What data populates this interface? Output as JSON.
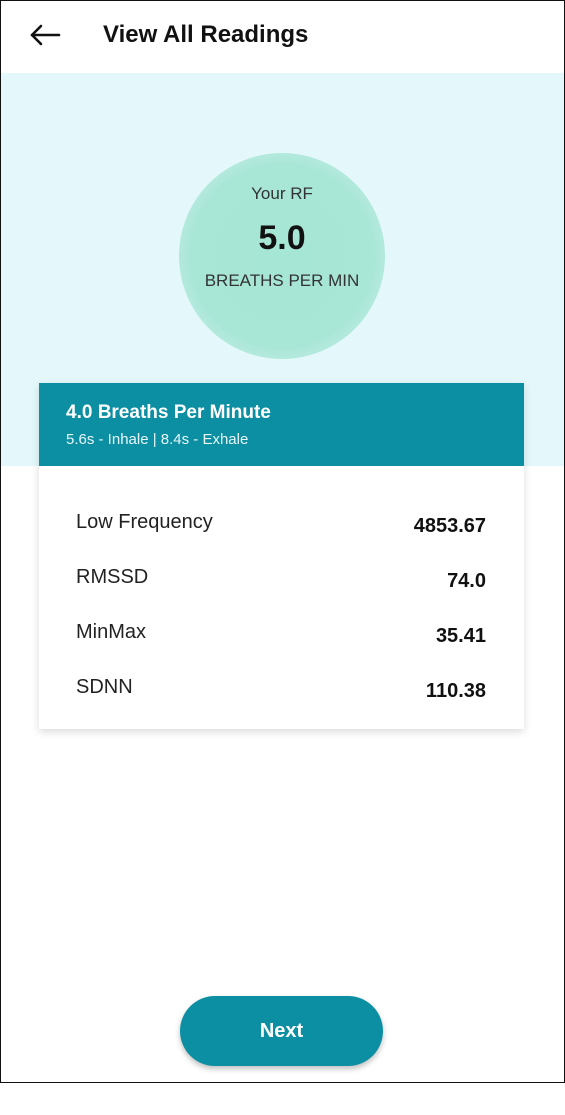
{
  "appbar": {
    "back_icon": "arrow-left-icon",
    "title": "View All Readings"
  },
  "hero": {
    "label": "Your RF",
    "value": "5.0",
    "unit": "BREATHS PER MIN",
    "circle_color": "#a8e6d6",
    "background_color": "#e4f8fb"
  },
  "card": {
    "title": "4.0 Breaths Per Minute",
    "subtitle": "5.6s - Inhale | 8.4s - Exhale",
    "header_color": "#0d8fa3",
    "rows": [
      {
        "label": "Low Frequency",
        "value": "4853.67"
      },
      {
        "label": "RMSSD",
        "value": "74.0"
      },
      {
        "label": "MinMax",
        "value": "35.41"
      },
      {
        "label": "SDNN",
        "value": "110.38"
      }
    ]
  },
  "footer": {
    "next_label": "Next",
    "accent_color": "#0d8fa3"
  }
}
